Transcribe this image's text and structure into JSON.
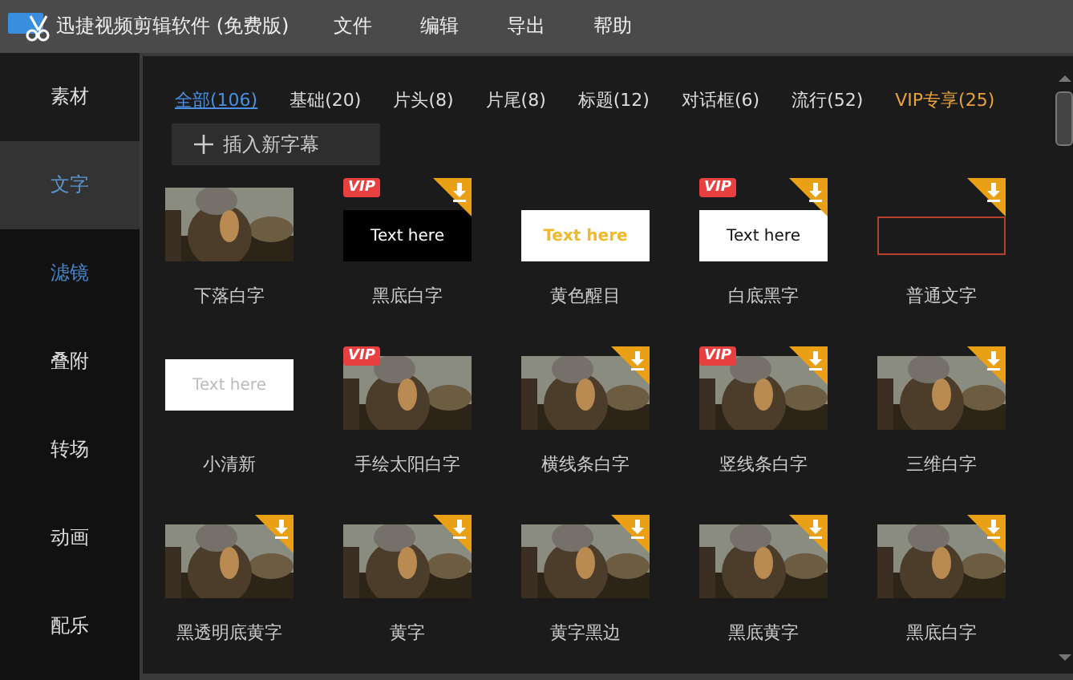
{
  "window": {
    "title": "迅捷视频剪辑软件 (免费版)"
  },
  "menu": [
    "文件",
    "编辑",
    "导出",
    "帮助"
  ],
  "sidebar": {
    "items": [
      {
        "label": "素材",
        "selected": false,
        "hovered": false
      },
      {
        "label": "文字",
        "selected": true,
        "hovered": false
      },
      {
        "label": "滤镜",
        "selected": false,
        "hovered": true
      },
      {
        "label": "叠附",
        "selected": false,
        "hovered": false
      },
      {
        "label": "转场",
        "selected": false,
        "hovered": false
      },
      {
        "label": "动画",
        "selected": false,
        "hovered": false
      },
      {
        "label": "配乐",
        "selected": false,
        "hovered": false
      }
    ]
  },
  "filters": [
    {
      "label": "全部(106)",
      "selected": true,
      "kind": "normal"
    },
    {
      "label": "基础(20)",
      "selected": false,
      "kind": "normal"
    },
    {
      "label": "片头(8)",
      "selected": false,
      "kind": "normal"
    },
    {
      "label": "片尾(8)",
      "selected": false,
      "kind": "normal"
    },
    {
      "label": "标题(12)",
      "selected": false,
      "kind": "normal"
    },
    {
      "label": "对话框(6)",
      "selected": false,
      "kind": "normal"
    },
    {
      "label": "流行(52)",
      "selected": false,
      "kind": "normal"
    },
    {
      "label": "VIP专享(25)",
      "selected": false,
      "kind": "vip"
    }
  ],
  "insert_button": {
    "label": "插入新字幕"
  },
  "tiles": [
    {
      "label": "下落白字",
      "download": false
    },
    {
      "label": "黑底白字",
      "kind": "dark-card",
      "preview_text": "Text here",
      "badge": "VIP",
      "download": true
    },
    {
      "label": "黄色醒目",
      "kind": "yellow-card",
      "preview_text": "Text here",
      "download": false
    },
    {
      "label": "白底黑字",
      "kind": "white-card",
      "preview_text": "Text here",
      "badge": "VIP",
      "download": true
    },
    {
      "label": "普通文字",
      "kind": "outline-card",
      "download": true
    },
    {
      "label": "小清新",
      "kind": "light-card",
      "preview_text": "Text  here",
      "download": false
    },
    {
      "label": "手绘太阳白字",
      "badge": "VIP",
      "download": false
    },
    {
      "label": "横线条白字",
      "download": true
    },
    {
      "label": "竖线条白字",
      "badge": "VIP",
      "download": true
    },
    {
      "label": "三维白字",
      "download": true
    },
    {
      "label": "黑透明底黄字",
      "download": true
    },
    {
      "label": "黄字",
      "download": true
    },
    {
      "label": "黄字黑边",
      "download": true
    },
    {
      "label": "黑底黄字",
      "download": true
    },
    {
      "label": "黑底白字",
      "download": true
    }
  ]
}
